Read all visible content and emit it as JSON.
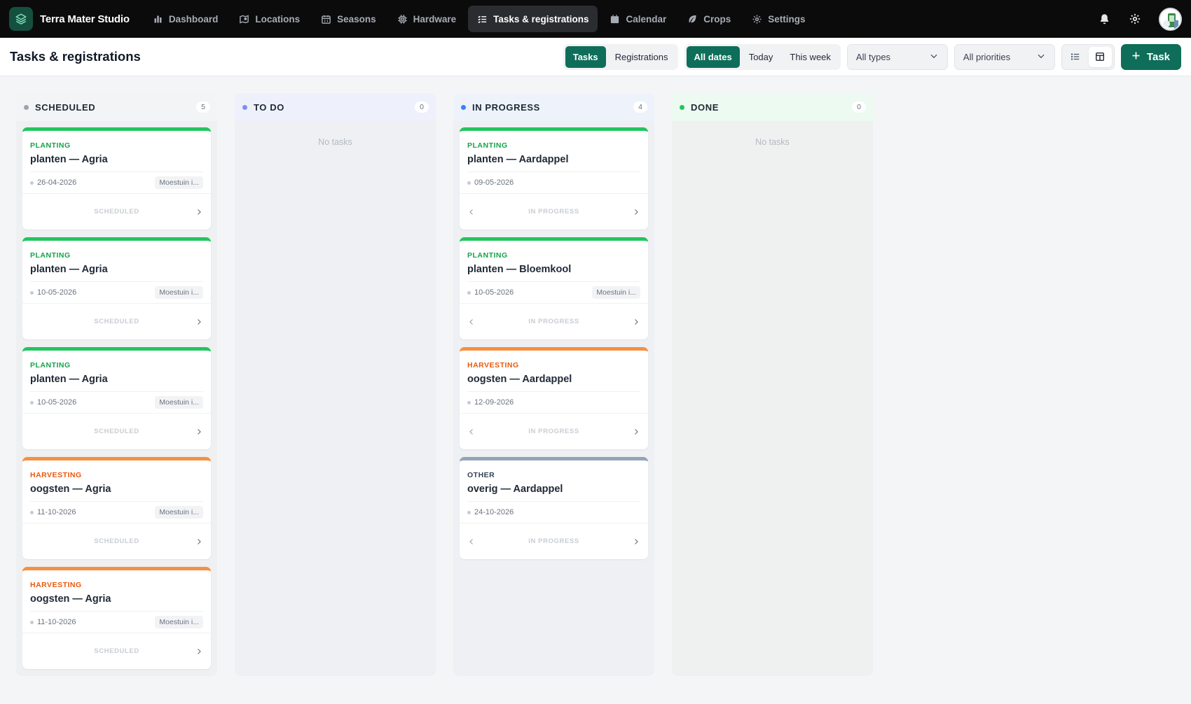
{
  "app": {
    "name": "Terra Mater Studio"
  },
  "nav": {
    "items": [
      {
        "label": "Dashboard",
        "icon": "bar-chart-icon"
      },
      {
        "label": "Locations",
        "icon": "map-icon"
      },
      {
        "label": "Seasons",
        "icon": "calendar-grid-icon"
      },
      {
        "label": "Hardware",
        "icon": "chip-icon"
      },
      {
        "label": "Tasks & registrations",
        "icon": "list-check-icon",
        "active": true
      },
      {
        "label": "Calendar",
        "icon": "calendar-icon"
      },
      {
        "label": "Crops",
        "icon": "leaf-icon"
      },
      {
        "label": "Settings",
        "icon": "gear-icon"
      }
    ]
  },
  "header": {
    "title": "Tasks & registrations",
    "mode_tabs": [
      "Tasks",
      "Registrations"
    ],
    "date_tabs": [
      "All dates",
      "Today",
      "This week"
    ],
    "type_filter": "All types",
    "priority_filter": "All priorities",
    "add_label": "Task"
  },
  "colors": {
    "accent": "#0e6e59",
    "planting": "#22c55e",
    "planting_text": "#16a34a",
    "harvesting": "#f59042",
    "harvesting_text": "#ea580c",
    "other": "#94a3b8",
    "other_text": "#334155"
  },
  "board": {
    "empty_label": "No tasks",
    "columns": [
      {
        "title": "SCHEDULED",
        "count": "5",
        "dot": "#9ca3af",
        "head_bg": "#f3f4f6",
        "bg": "#eef0f2",
        "status": "SCHEDULED",
        "cards": [
          {
            "type": "PLANTING",
            "kind": "planting",
            "title": "planten — Agria",
            "date": "26-04-2026",
            "location": "Moestuin i..."
          },
          {
            "type": "PLANTING",
            "kind": "planting",
            "title": "planten — Agria",
            "date": "10-05-2026",
            "location": "Moestuin i..."
          },
          {
            "type": "PLANTING",
            "kind": "planting",
            "title": "planten — Agria",
            "date": "10-05-2026",
            "location": "Moestuin i..."
          },
          {
            "type": "HARVESTING",
            "kind": "harvesting",
            "title": "oogsten — Agria",
            "date": "11-10-2026",
            "location": "Moestuin i..."
          },
          {
            "type": "HARVESTING",
            "kind": "harvesting",
            "title": "oogsten — Agria",
            "date": "11-10-2026",
            "location": "Moestuin i..."
          }
        ]
      },
      {
        "title": "TO DO",
        "count": "0",
        "dot": "#818cf8",
        "head_bg": "#eef1fb",
        "bg": "#eef0f3",
        "status": "TO DO",
        "cards": []
      },
      {
        "title": "IN PROGRESS",
        "count": "4",
        "dot": "#3b82f6",
        "head_bg": "#eef3fb",
        "bg": "#eef0f3",
        "status": "IN PROGRESS",
        "cards": [
          {
            "type": "PLANTING",
            "kind": "planting",
            "title": "planten — Aardappel",
            "date": "09-05-2026",
            "location": ""
          },
          {
            "type": "PLANTING",
            "kind": "planting",
            "title": "planten — Bloemkool",
            "date": "10-05-2026",
            "location": "Moestuin i..."
          },
          {
            "type": "HARVESTING",
            "kind": "harvesting",
            "title": "oogsten — Aardappel",
            "date": "12-09-2026",
            "location": ""
          },
          {
            "type": "OTHER",
            "kind": "other",
            "title": "overig — Aardappel",
            "date": "24-10-2026",
            "location": ""
          }
        ]
      },
      {
        "title": "DONE",
        "count": "0",
        "dot": "#22c55e",
        "head_bg": "#ecfaf1",
        "bg": "#eef1f0",
        "status": "DONE",
        "cards": []
      }
    ]
  }
}
